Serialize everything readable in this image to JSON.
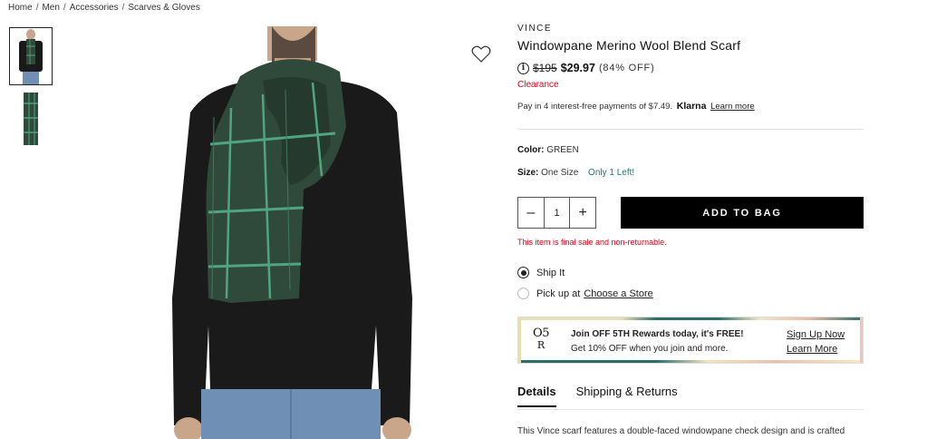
{
  "breadcrumb": {
    "items": [
      "Home",
      "Men",
      "Accessories",
      "Scarves & Gloves"
    ],
    "separator": "/"
  },
  "product": {
    "brand": "VINCE",
    "title": "Windowpane Merino Wool Blend Scarf",
    "original_price": "$195",
    "sale_price": "$29.97",
    "discount": "(84% OFF)",
    "clearance": "Clearance",
    "info_icon": "i"
  },
  "klarna": {
    "prefix": "Pay in 4 interest-free payments of $7.49.",
    "logo": "Klarna",
    "learn_more": "Learn more"
  },
  "options": {
    "color_label": "Color:",
    "color_value": "GREEN",
    "size_label": "Size:",
    "size_value": "One Size",
    "stock_note": "Only 1 Left!"
  },
  "purchase": {
    "minus": "–",
    "quantity": "1",
    "plus": "+",
    "add_to_bag": "ADD TO BAG",
    "final_sale_note": "This item is final sale and non-returnable."
  },
  "fulfillment": {
    "ship_label": "Ship It",
    "pickup_label": "Pick up at",
    "choose_store": "Choose a Store"
  },
  "rewards": {
    "logo_top": "O5",
    "logo_bottom": "R",
    "headline": "Join OFF 5TH Rewards today, it's FREE!",
    "subline": "Get 10% OFF when you join and more.",
    "signup": "Sign Up Now",
    "learn_more": "Learn More"
  },
  "tabs": [
    "Details",
    "Shipping & Returns"
  ],
  "description": "This Vince scarf features a double-faced windowpane check design and is crafted",
  "colors": {
    "clearance_red": "#e0001b",
    "stock_green": "#1f7a6a",
    "scarf_green": "#2f4a3a",
    "scarf_stripe": "#4fa57f",
    "shirt": "#1a1a1a",
    "jeans": "#6f8fb5"
  },
  "icons": {
    "wishlist": "heart-icon",
    "info": "info-icon"
  }
}
